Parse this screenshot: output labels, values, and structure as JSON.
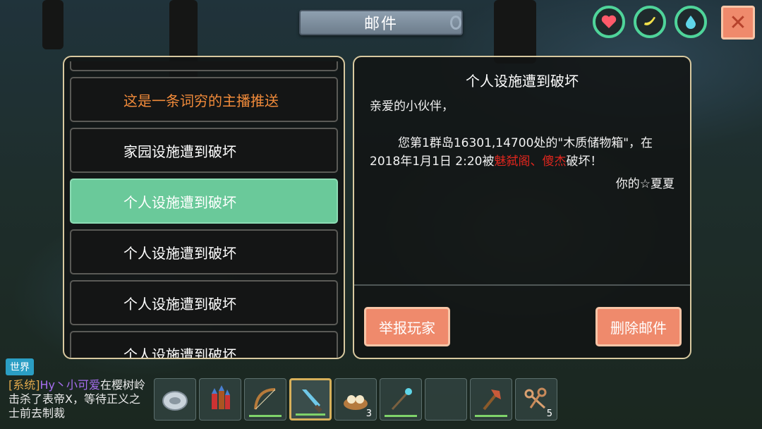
{
  "header": {
    "title": "邮件"
  },
  "status": {
    "health_icon": "heart-icon",
    "hunger_icon": "banana-icon",
    "water_icon": "water-drop-icon",
    "ring_color": "#4fd49a"
  },
  "close_label": "✕",
  "mail_list": {
    "items": [
      {
        "label": "这是一条词穷的主播推送",
        "type": "promo"
      },
      {
        "label": "家园设施遭到破坏",
        "type": "normal"
      },
      {
        "label": "个人设施遭到破坏",
        "type": "active"
      },
      {
        "label": "个人设施遭到破坏",
        "type": "normal"
      },
      {
        "label": "个人设施遭到破坏",
        "type": "normal"
      },
      {
        "label": "个人设施遭到破坏",
        "type": "normal"
      }
    ]
  },
  "mail_detail": {
    "title": "个人设施遭到破坏",
    "greeting": "亲爱的小伙伴，",
    "body_before": "您第1群岛16301,14700处的\"木质储物箱\"，在2018年1月1日 2:20被",
    "attacker": "魅弑阁、傻杰",
    "body_after": "破坏！",
    "signature": "你的☆夏夏",
    "report_button": "举报玩家",
    "delete_button": "删除邮件"
  },
  "chat": {
    "channel": "世界",
    "system_tag": "[系统]",
    "player": "Hy丶小可爱",
    "message": "在樱树岭击杀了表帝Ⅹ，等待正义之士前去制裁"
  },
  "hotbar": {
    "slots": [
      {
        "icon": "shield-disc-icon",
        "count": ""
      },
      {
        "icon": "firework-icon",
        "count": ""
      },
      {
        "icon": "bow-icon",
        "count": ""
      },
      {
        "icon": "crystal-sword-icon",
        "count": "",
        "selected": true
      },
      {
        "icon": "dumpling-steamer-icon",
        "count": "3"
      },
      {
        "icon": "magic-staff-icon",
        "count": ""
      },
      {
        "icon": "empty-slot",
        "count": ""
      },
      {
        "icon": "axe-icon",
        "count": ""
      },
      {
        "icon": "keys-icon",
        "count": "5"
      }
    ]
  }
}
